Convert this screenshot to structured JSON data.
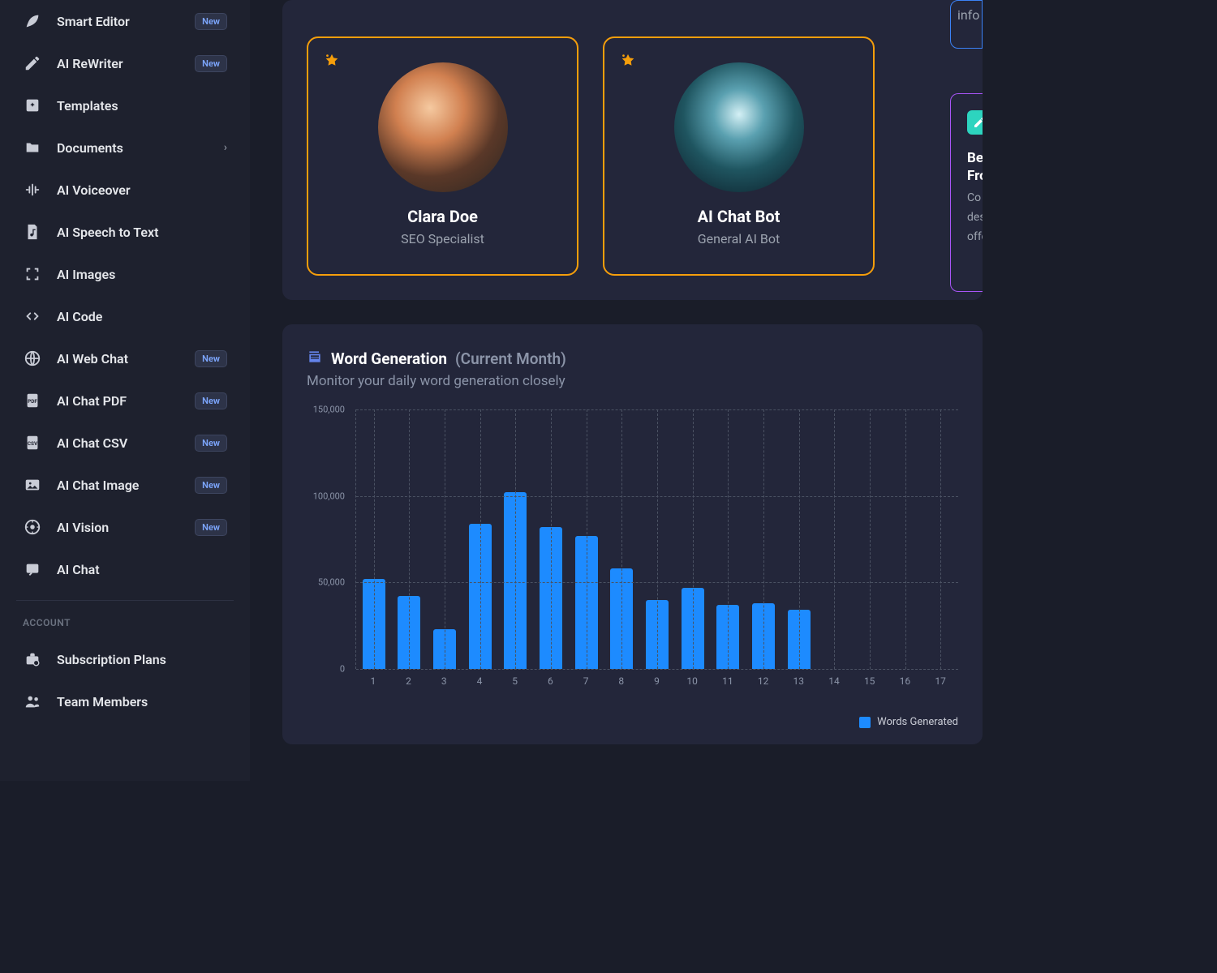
{
  "sidebar": {
    "items": [
      {
        "label": "Smart Editor",
        "new": true,
        "icon": "feather"
      },
      {
        "label": "AI ReWriter",
        "new": true,
        "icon": "pen"
      },
      {
        "label": "Templates",
        "new": false,
        "icon": "sparkle-box"
      },
      {
        "label": "Documents",
        "new": false,
        "icon": "folder",
        "expandable": true
      },
      {
        "label": "AI Voiceover",
        "new": false,
        "icon": "waveform"
      },
      {
        "label": "AI Speech to Text",
        "new": false,
        "icon": "music-file"
      },
      {
        "label": "AI Images",
        "new": false,
        "icon": "frame"
      },
      {
        "label": "AI Code",
        "new": false,
        "icon": "code"
      },
      {
        "label": "AI Web Chat",
        "new": true,
        "icon": "globe"
      },
      {
        "label": "AI Chat PDF",
        "new": true,
        "icon": "pdf"
      },
      {
        "label": "AI Chat CSV",
        "new": true,
        "icon": "csv"
      },
      {
        "label": "AI Chat Image",
        "new": true,
        "icon": "image"
      },
      {
        "label": "AI Vision",
        "new": true,
        "icon": "vision"
      },
      {
        "label": "AI Chat",
        "new": false,
        "icon": "chat"
      }
    ],
    "account_label": "ACCOUNT",
    "account_items": [
      {
        "label": "Subscription Plans",
        "icon": "briefcase"
      },
      {
        "label": "Team Members",
        "icon": "people"
      }
    ],
    "new_badge": "New"
  },
  "agents": [
    {
      "name": "Clara Doe",
      "role": "SEO Specialist"
    },
    {
      "name": "AI Chat Bot",
      "role": "General AI Bot"
    }
  ],
  "info_card_1": {
    "text": "info"
  },
  "info_card_2": {
    "title_line1": "Be",
    "title_line2": "Fro",
    "desc_line1": "Co",
    "desc_line2": "des",
    "desc_line3": "offe"
  },
  "chart": {
    "title": "Word Generation",
    "subtitle": "(Current Month)",
    "description": "Monitor your daily word generation closely",
    "legend": "Words Generated"
  },
  "chart_data": {
    "type": "bar",
    "title": "Word Generation (Current Month)",
    "xlabel": "",
    "ylabel": "",
    "ylim": [
      0,
      150000
    ],
    "y_ticks": [
      0,
      50000,
      100000,
      150000
    ],
    "y_tick_labels": [
      "0",
      "50,000",
      "100,000",
      "150,000"
    ],
    "categories": [
      "1",
      "2",
      "3",
      "4",
      "5",
      "6",
      "7",
      "8",
      "9",
      "10",
      "11",
      "12",
      "13",
      "14",
      "15",
      "16",
      "17"
    ],
    "series": [
      {
        "name": "Words Generated",
        "color": "#1d8bff",
        "values": [
          52000,
          42000,
          23000,
          84000,
          102000,
          82000,
          77000,
          58000,
          40000,
          47000,
          37000,
          38000,
          34000,
          0,
          0,
          0,
          0
        ]
      }
    ]
  }
}
